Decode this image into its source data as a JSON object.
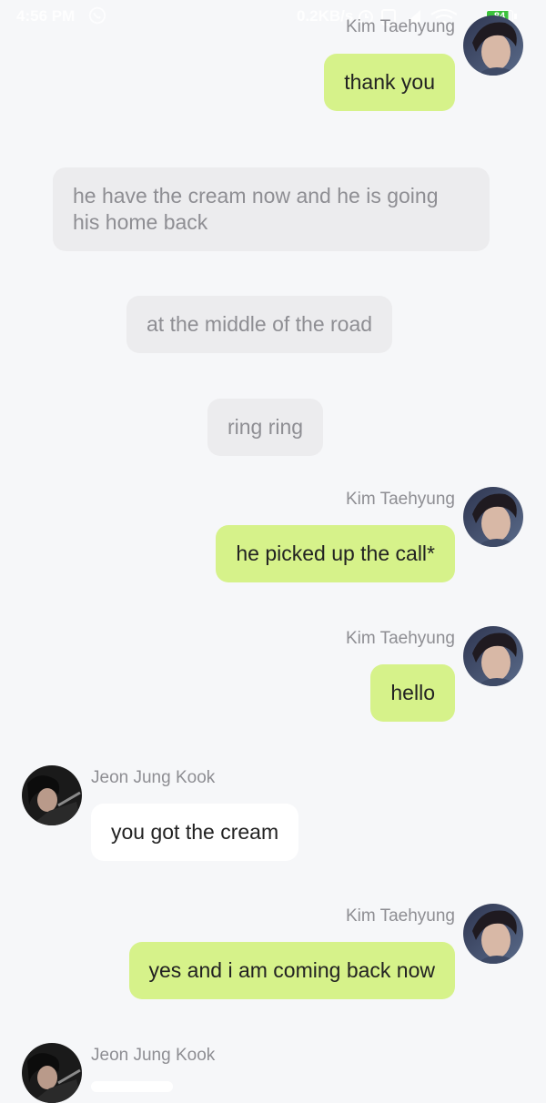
{
  "status_bar": {
    "time": "4:56 PM",
    "net_speed": "0.2KB/s",
    "battery": "84",
    "icons": [
      "whatsapp-icon",
      "alarm-icon",
      "sim-icon",
      "signal-icon",
      "wifi-icon",
      "battery-icon"
    ]
  },
  "colors": {
    "background": "#f6f7f9",
    "outgoing_bubble": "#d6f28a",
    "incoming_bubble": "#ffffff",
    "narration_bubble": "#ececee",
    "name_text": "#8e8e93"
  },
  "messages": [
    {
      "sender": "Kim Taehyung",
      "text": "thank you"
    },
    {
      "text": "he have the cream now and he is going his home back"
    },
    {
      "text": "at the middle of the road"
    },
    {
      "text": "ring ring"
    },
    {
      "sender": "Kim Taehyung",
      "text": "he picked up the call*"
    },
    {
      "sender": "Kim Taehyung",
      "text": "hello"
    },
    {
      "sender": "Jeon Jung Kook",
      "text": "you got the cream"
    },
    {
      "sender": "Kim Taehyung",
      "text": "yes and i am coming back now"
    },
    {
      "sender": "Jeon Jung Kook",
      "text": ""
    }
  ]
}
